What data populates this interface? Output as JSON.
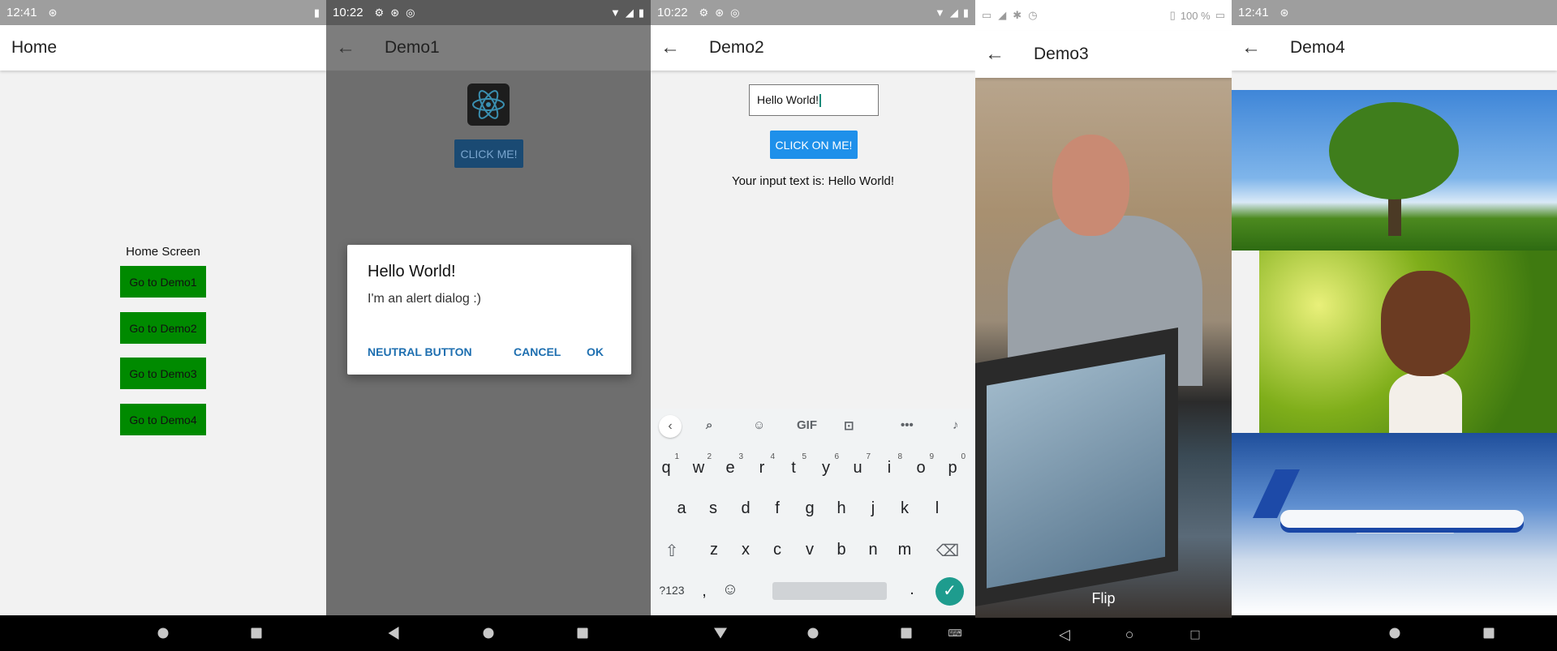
{
  "panel1": {
    "status": {
      "time": "12:41"
    },
    "appbar": {
      "title": "Home"
    },
    "home_label": "Home Screen",
    "buttons": [
      "Go to Demo1",
      "Go to Demo2",
      "Go to Demo3",
      "Go to Demo4"
    ],
    "accent": "#008a00"
  },
  "panel2": {
    "status": {
      "time": "10:22"
    },
    "appbar": {
      "title": "Demo1"
    },
    "click_label": "CLICK ME!",
    "dialog": {
      "title": "Hello World!",
      "message": "I'm an alert dialog :)",
      "neutral": "NEUTRAL BUTTON",
      "cancel": "CANCEL",
      "ok": "OK"
    }
  },
  "panel3": {
    "status": {
      "time": "10:22"
    },
    "appbar": {
      "title": "Demo2"
    },
    "input_value": "Hello World!",
    "button_label": "CLICK ON ME!",
    "result_text": "Your input text is: Hello World!",
    "keyboard": {
      "toolbar_gif": "GIF",
      "toolbar_more": "•••",
      "row1": [
        "q",
        "w",
        "e",
        "r",
        "t",
        "y",
        "u",
        "i",
        "o",
        "p"
      ],
      "row1_hints": [
        "1",
        "2",
        "3",
        "4",
        "5",
        "6",
        "7",
        "8",
        "9",
        "0"
      ],
      "row2": [
        "a",
        "s",
        "d",
        "f",
        "g",
        "h",
        "j",
        "k",
        "l"
      ],
      "row3": [
        "z",
        "x",
        "c",
        "v",
        "b",
        "n",
        "m"
      ],
      "symbols_key": "?123",
      "comma_key": ",",
      "period_key": "."
    }
  },
  "panel4": {
    "status": {
      "battery": "100 %"
    },
    "appbar": {
      "title": "Demo3"
    },
    "flip_label": "Flip"
  },
  "panel5": {
    "status": {
      "time": "12:41"
    },
    "appbar": {
      "title": "Demo4"
    }
  }
}
